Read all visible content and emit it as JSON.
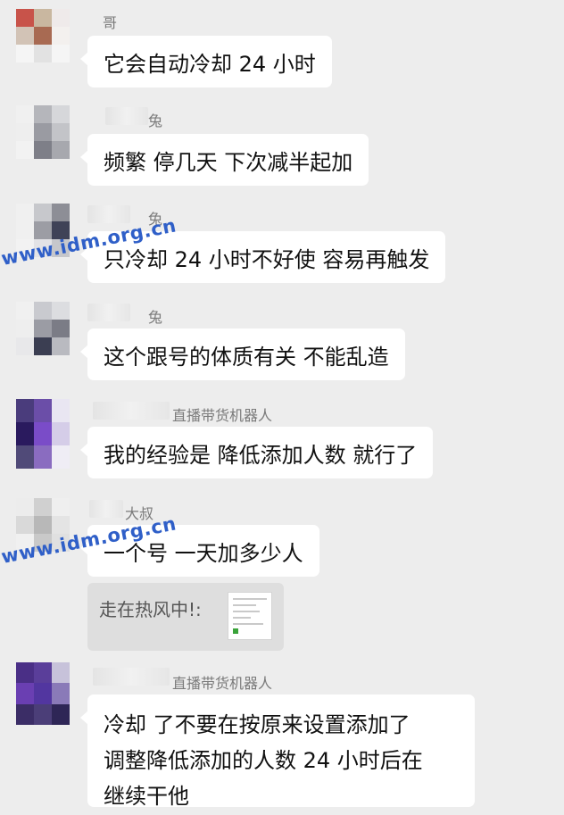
{
  "watermark": "www.idm.org.cn",
  "messages": [
    {
      "sender": "哥",
      "text": "它会自动冷却 24 小时"
    },
    {
      "sender": "兔",
      "text": "频繁 停几天 下次减半起加"
    },
    {
      "sender": "兔",
      "text": "只冷却 24 小时不好使 容易再触发"
    },
    {
      "sender": "兔",
      "text": "这个跟号的体质有关 不能乱造"
    },
    {
      "sender": "直播带货机器人",
      "text": "我的经验是  降低添加人数 就行了"
    },
    {
      "sender": "大叔",
      "text": "一个号 一天加多少人"
    },
    {
      "sender": "直播带货机器人",
      "lines": [
        "冷却 了不要在按原来设置添加了",
        "调整降低添加的人数  24 小时后在",
        "继续干他"
      ]
    }
  ],
  "quote": {
    "label": "走在热风中!:"
  }
}
